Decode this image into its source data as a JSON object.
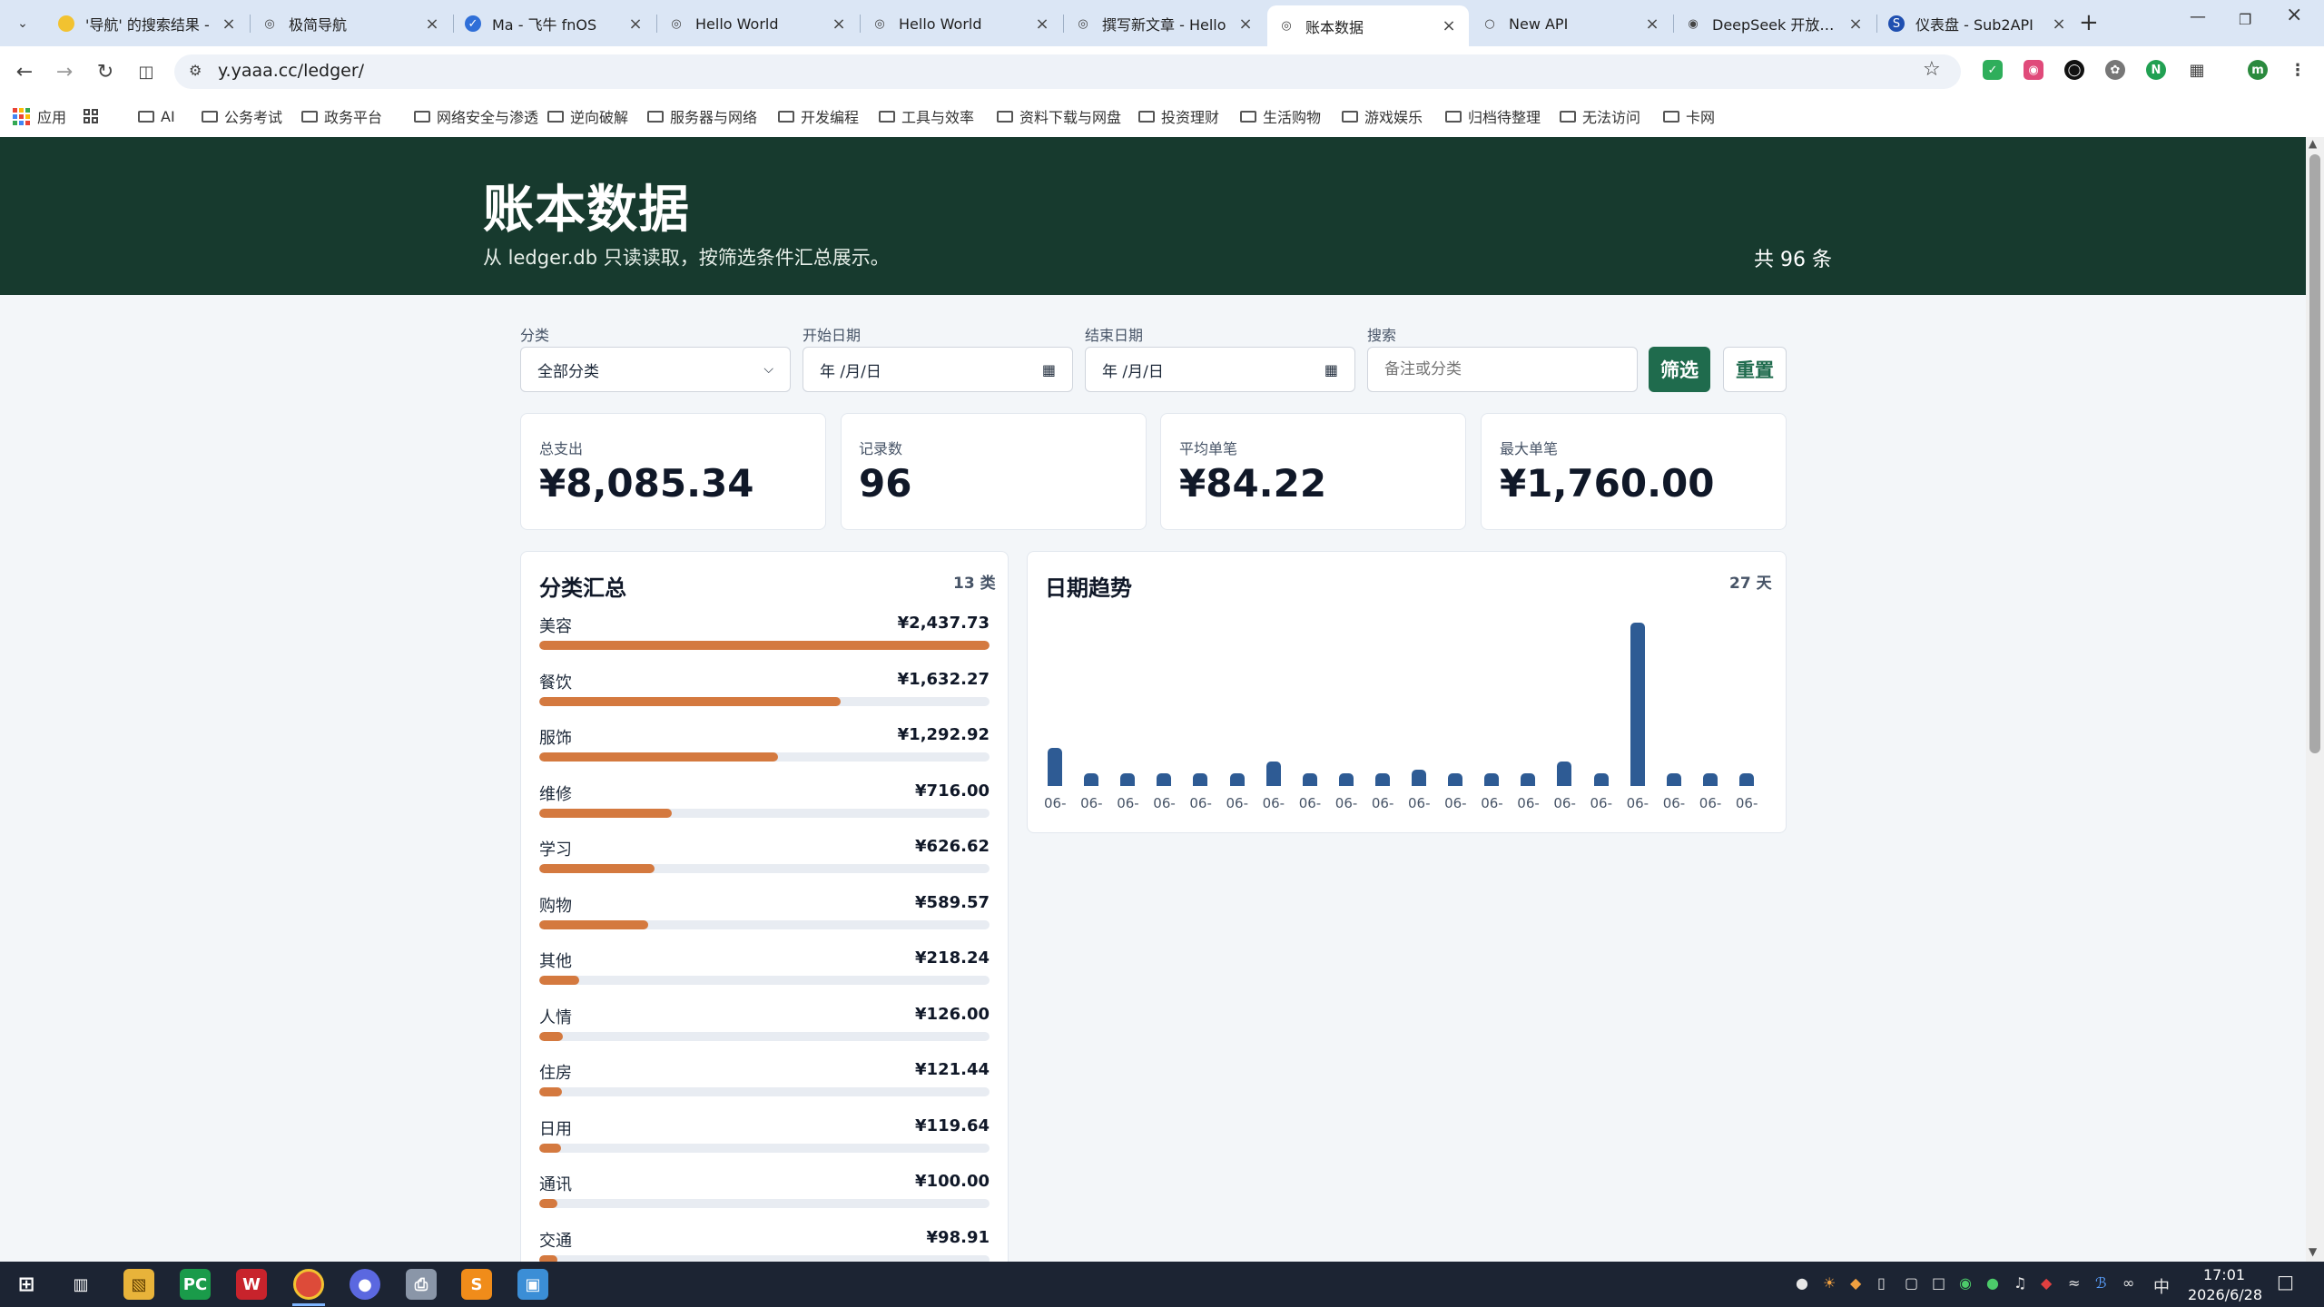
{
  "browser": {
    "tabs": [
      {
        "title": "'导航' 的搜索结果 -",
        "fav": "search-fav"
      },
      {
        "title": "极简导航",
        "fav": "globe"
      },
      {
        "title": "Ma - 飞牛 fnOS",
        "fav": "doc"
      },
      {
        "title": "Hello World",
        "fav": "globe"
      },
      {
        "title": "Hello World",
        "fav": "globe"
      },
      {
        "title": "撰写新文章 - Hello",
        "fav": "globe"
      },
      {
        "title": "账本数据",
        "fav": "globe"
      },
      {
        "title": "New API",
        "fav": "ring"
      },
      {
        "title": "DeepSeek 开放平台",
        "fav": "whale"
      },
      {
        "title": "仪表盘 - Sub2API",
        "fav": "s-logo"
      }
    ],
    "active_tab_index": 6,
    "url": "y.yaaa.cc/ledger/",
    "bookmarks": [
      "应用",
      "AI",
      "公务考试",
      "政务平台",
      "网络安全与渗透",
      "逆向破解",
      "服务器与网络",
      "开发编程",
      "工具与效率",
      "资料下载与网盘",
      "投资理财",
      "生活购物",
      "游戏娱乐",
      "归档待整理",
      "无法访问",
      "卡网"
    ]
  },
  "hero": {
    "title": "账本数据",
    "subtitle": "从 ledger.db 只读读取，按筛选条件汇总展示。",
    "count": "共 96 条"
  },
  "filters": {
    "category_label": "分类",
    "category_value": "全部分类",
    "start_label": "开始日期",
    "start_value": "年 /月/日",
    "end_label": "结束日期",
    "end_value": "年 /月/日",
    "search_label": "搜索",
    "search_placeholder": "备注或分类",
    "filter_button": "筛选",
    "reset_button": "重置"
  },
  "stats": [
    {
      "label": "总支出",
      "value": "¥8,085.34"
    },
    {
      "label": "记录数",
      "value": "96"
    },
    {
      "label": "平均单笔",
      "value": "¥84.22"
    },
    {
      "label": "最大单笔",
      "value": "¥1,760.00"
    }
  ],
  "category_summary": {
    "title": "分类汇总",
    "meta": "13 类",
    "bar_color": "#d4793f",
    "items": [
      {
        "name": "美容",
        "amount": "¥2,437.73",
        "value": 2437.73
      },
      {
        "name": "餐饮",
        "amount": "¥1,632.27",
        "value": 1632.27
      },
      {
        "name": "服饰",
        "amount": "¥1,292.92",
        "value": 1292.92
      },
      {
        "name": "维修",
        "amount": "¥716.00",
        "value": 716.0
      },
      {
        "name": "学习",
        "amount": "¥626.62",
        "value": 626.62
      },
      {
        "name": "购物",
        "amount": "¥589.57",
        "value": 589.57
      },
      {
        "name": "其他",
        "amount": "¥218.24",
        "value": 218.24
      },
      {
        "name": "人情",
        "amount": "¥126.00",
        "value": 126.0
      },
      {
        "name": "住房",
        "amount": "¥121.44",
        "value": 121.44
      },
      {
        "name": "日用",
        "amount": "¥119.64",
        "value": 119.64
      },
      {
        "name": "通讯",
        "amount": "¥100.00",
        "value": 100.0
      },
      {
        "name": "交通",
        "amount": "¥98.91",
        "value": 98.91
      }
    ]
  },
  "date_trend": {
    "title": "日期趋势",
    "meta": "27 天",
    "bar_color": "#2e5b94"
  },
  "chart_data": {
    "type": "bar",
    "title": "日期趋势",
    "categories": [
      "06-",
      "06-",
      "06-",
      "06-",
      "06-",
      "06-",
      "06-",
      "06-",
      "06-",
      "06-",
      "06-",
      "06-",
      "06-",
      "06-",
      "06-",
      "06-",
      "06-",
      "06-",
      "06-",
      "06-"
    ],
    "values": [
      410,
      140,
      140,
      140,
      140,
      140,
      260,
      140,
      140,
      140,
      180,
      140,
      140,
      140,
      260,
      140,
      1760,
      140,
      140,
      140
    ],
    "ylim": [
      0,
      1760
    ],
    "grid": false,
    "legend": "none"
  },
  "taskbar": {
    "time": "17:01",
    "date": "2026/6/28",
    "ime": "中"
  }
}
